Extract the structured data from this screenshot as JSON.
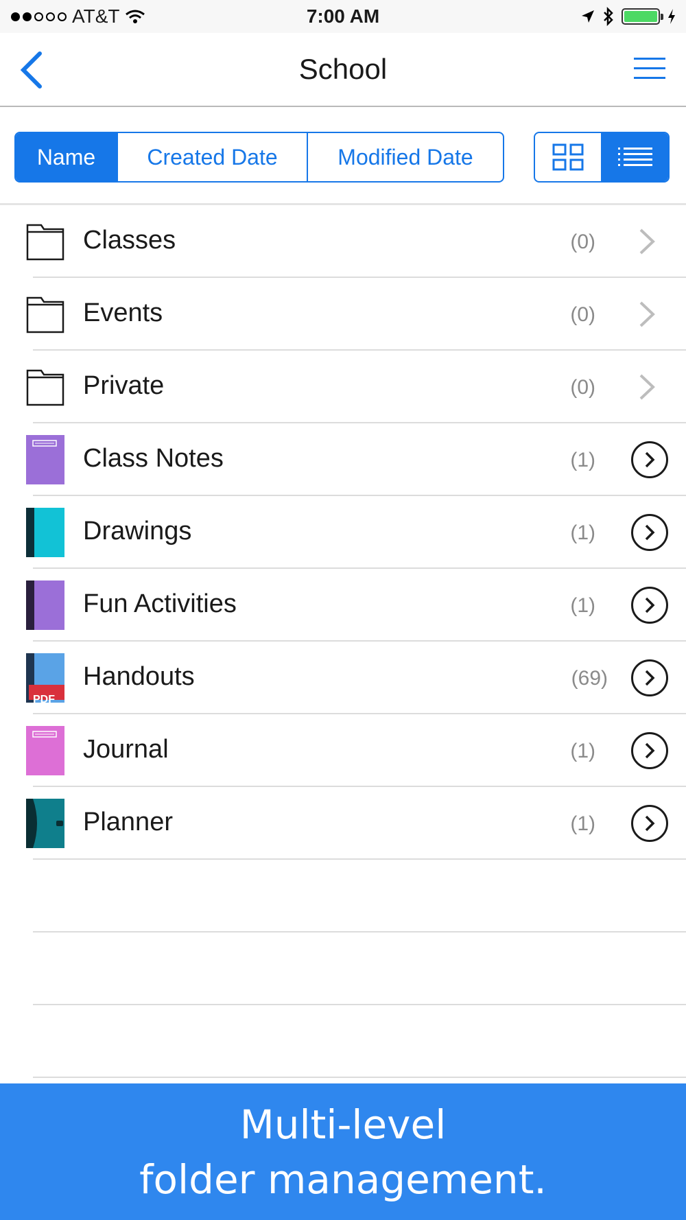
{
  "status_bar": {
    "carrier": "AT&T",
    "time": "7:00 AM",
    "signal_bars_filled": 2,
    "signal_bars_total": 5,
    "battery_level": 1.0,
    "battery_color": "#4cd964"
  },
  "nav": {
    "title": "School",
    "back_icon": "chevron-left-icon",
    "menu_icon": "hamburger-menu-icon"
  },
  "sort_tabs": [
    {
      "label": "Name",
      "active": true
    },
    {
      "label": "Created Date",
      "active": false
    },
    {
      "label": "Modified Date",
      "active": false
    }
  ],
  "view_toggle": {
    "grid_icon": "grid-view-icon",
    "list_icon": "list-view-icon",
    "active": "list"
  },
  "items": [
    {
      "label": "Classes",
      "count": "(0)",
      "type": "folder"
    },
    {
      "label": "Events",
      "count": "(0)",
      "type": "folder"
    },
    {
      "label": "Private",
      "count": "(0)",
      "type": "folder"
    },
    {
      "label": "Class Notes",
      "count": "(1)",
      "type": "notebook",
      "color": "#9b6fd8"
    },
    {
      "label": "Drawings",
      "count": "(1)",
      "type": "notebook",
      "color": "#12c2d6"
    },
    {
      "label": "Fun Activities",
      "count": "(1)",
      "type": "notebook",
      "color": "#9b6fd8"
    },
    {
      "label": "Handouts",
      "count": "(69)",
      "type": "pdf",
      "color": "#5aa3e6",
      "badge": "PDF"
    },
    {
      "label": "Journal",
      "count": "(1)",
      "type": "notebook",
      "color": "#dd6fd6"
    },
    {
      "label": "Planner",
      "count": "(1)",
      "type": "planner",
      "color": "#0f7f8c"
    }
  ],
  "banner": {
    "line1": "Multi-level",
    "line2": "folder management.",
    "color": "#2f87ee"
  }
}
